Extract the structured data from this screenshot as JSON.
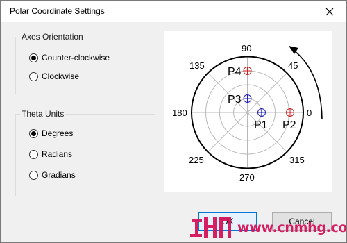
{
  "window": {
    "title": "Polar Coordinate Settings"
  },
  "axes_orientation": {
    "label": "Axes Orientation",
    "options": [
      {
        "label": "Counter-clockwise",
        "checked": true
      },
      {
        "label": "Clockwise",
        "checked": false
      }
    ]
  },
  "theta_units": {
    "label": "Theta Units",
    "options": [
      {
        "label": "Degrees",
        "checked": true
      },
      {
        "label": "Radians",
        "checked": false
      },
      {
        "label": "Gradians",
        "checked": false
      }
    ]
  },
  "polar_preview": {
    "angle_labels": [
      "0",
      "45",
      "90",
      "135",
      "180",
      "225",
      "270",
      "315"
    ],
    "points": [
      {
        "name": "P1",
        "color": "#1f1fbf"
      },
      {
        "name": "P2",
        "color": "#d02020"
      },
      {
        "name": "P3",
        "color": "#1f1fbf"
      },
      {
        "name": "P4",
        "color": "#d02020"
      }
    ]
  },
  "buttons": {
    "ok": "OK",
    "cancel": "Cancel"
  },
  "watermark": {
    "text": "www.cnmhg.com"
  },
  "colors": {
    "accent": "#0078d7",
    "watermark": "#d4145a"
  }
}
